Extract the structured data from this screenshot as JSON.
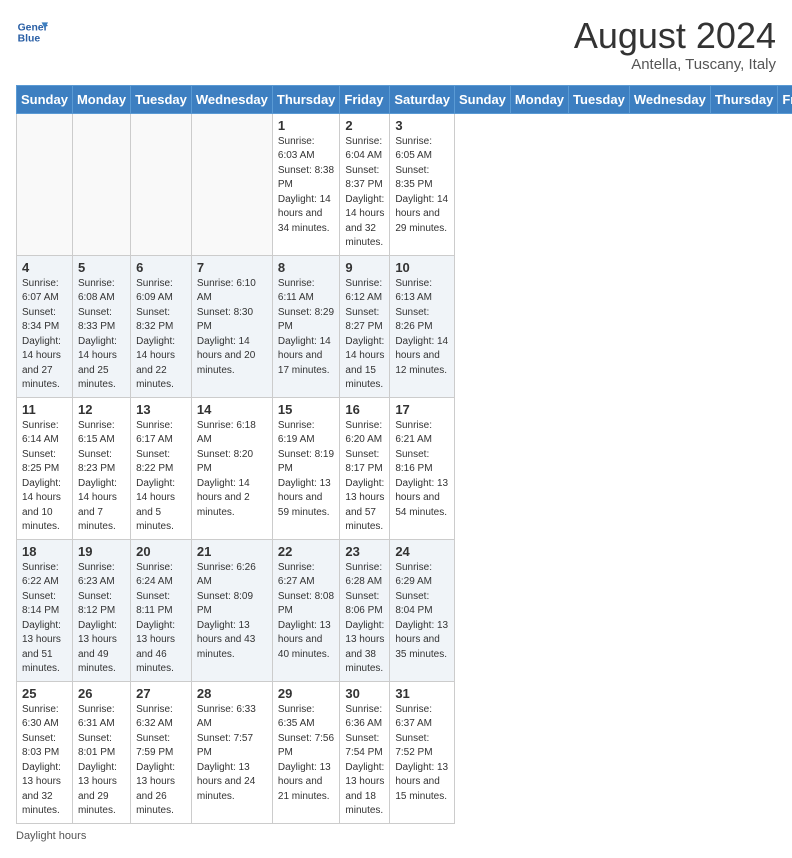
{
  "header": {
    "logo_line1": "General",
    "logo_line2": "Blue",
    "month_year": "August 2024",
    "location": "Antella, Tuscany, Italy"
  },
  "days_of_week": [
    "Sunday",
    "Monday",
    "Tuesday",
    "Wednesday",
    "Thursday",
    "Friday",
    "Saturday"
  ],
  "weeks": [
    [
      {
        "day": "",
        "info": ""
      },
      {
        "day": "",
        "info": ""
      },
      {
        "day": "",
        "info": ""
      },
      {
        "day": "",
        "info": ""
      },
      {
        "day": "1",
        "info": "Sunrise: 6:03 AM\nSunset: 8:38 PM\nDaylight: 14 hours and 34 minutes."
      },
      {
        "day": "2",
        "info": "Sunrise: 6:04 AM\nSunset: 8:37 PM\nDaylight: 14 hours and 32 minutes."
      },
      {
        "day": "3",
        "info": "Sunrise: 6:05 AM\nSunset: 8:35 PM\nDaylight: 14 hours and 29 minutes."
      }
    ],
    [
      {
        "day": "4",
        "info": "Sunrise: 6:07 AM\nSunset: 8:34 PM\nDaylight: 14 hours and 27 minutes."
      },
      {
        "day": "5",
        "info": "Sunrise: 6:08 AM\nSunset: 8:33 PM\nDaylight: 14 hours and 25 minutes."
      },
      {
        "day": "6",
        "info": "Sunrise: 6:09 AM\nSunset: 8:32 PM\nDaylight: 14 hours and 22 minutes."
      },
      {
        "day": "7",
        "info": "Sunrise: 6:10 AM\nSunset: 8:30 PM\nDaylight: 14 hours and 20 minutes."
      },
      {
        "day": "8",
        "info": "Sunrise: 6:11 AM\nSunset: 8:29 PM\nDaylight: 14 hours and 17 minutes."
      },
      {
        "day": "9",
        "info": "Sunrise: 6:12 AM\nSunset: 8:27 PM\nDaylight: 14 hours and 15 minutes."
      },
      {
        "day": "10",
        "info": "Sunrise: 6:13 AM\nSunset: 8:26 PM\nDaylight: 14 hours and 12 minutes."
      }
    ],
    [
      {
        "day": "11",
        "info": "Sunrise: 6:14 AM\nSunset: 8:25 PM\nDaylight: 14 hours and 10 minutes."
      },
      {
        "day": "12",
        "info": "Sunrise: 6:15 AM\nSunset: 8:23 PM\nDaylight: 14 hours and 7 minutes."
      },
      {
        "day": "13",
        "info": "Sunrise: 6:17 AM\nSunset: 8:22 PM\nDaylight: 14 hours and 5 minutes."
      },
      {
        "day": "14",
        "info": "Sunrise: 6:18 AM\nSunset: 8:20 PM\nDaylight: 14 hours and 2 minutes."
      },
      {
        "day": "15",
        "info": "Sunrise: 6:19 AM\nSunset: 8:19 PM\nDaylight: 13 hours and 59 minutes."
      },
      {
        "day": "16",
        "info": "Sunrise: 6:20 AM\nSunset: 8:17 PM\nDaylight: 13 hours and 57 minutes."
      },
      {
        "day": "17",
        "info": "Sunrise: 6:21 AM\nSunset: 8:16 PM\nDaylight: 13 hours and 54 minutes."
      }
    ],
    [
      {
        "day": "18",
        "info": "Sunrise: 6:22 AM\nSunset: 8:14 PM\nDaylight: 13 hours and 51 minutes."
      },
      {
        "day": "19",
        "info": "Sunrise: 6:23 AM\nSunset: 8:12 PM\nDaylight: 13 hours and 49 minutes."
      },
      {
        "day": "20",
        "info": "Sunrise: 6:24 AM\nSunset: 8:11 PM\nDaylight: 13 hours and 46 minutes."
      },
      {
        "day": "21",
        "info": "Sunrise: 6:26 AM\nSunset: 8:09 PM\nDaylight: 13 hours and 43 minutes."
      },
      {
        "day": "22",
        "info": "Sunrise: 6:27 AM\nSunset: 8:08 PM\nDaylight: 13 hours and 40 minutes."
      },
      {
        "day": "23",
        "info": "Sunrise: 6:28 AM\nSunset: 8:06 PM\nDaylight: 13 hours and 38 minutes."
      },
      {
        "day": "24",
        "info": "Sunrise: 6:29 AM\nSunset: 8:04 PM\nDaylight: 13 hours and 35 minutes."
      }
    ],
    [
      {
        "day": "25",
        "info": "Sunrise: 6:30 AM\nSunset: 8:03 PM\nDaylight: 13 hours and 32 minutes."
      },
      {
        "day": "26",
        "info": "Sunrise: 6:31 AM\nSunset: 8:01 PM\nDaylight: 13 hours and 29 minutes."
      },
      {
        "day": "27",
        "info": "Sunrise: 6:32 AM\nSunset: 7:59 PM\nDaylight: 13 hours and 26 minutes."
      },
      {
        "day": "28",
        "info": "Sunrise: 6:33 AM\nSunset: 7:57 PM\nDaylight: 13 hours and 24 minutes."
      },
      {
        "day": "29",
        "info": "Sunrise: 6:35 AM\nSunset: 7:56 PM\nDaylight: 13 hours and 21 minutes."
      },
      {
        "day": "30",
        "info": "Sunrise: 6:36 AM\nSunset: 7:54 PM\nDaylight: 13 hours and 18 minutes."
      },
      {
        "day": "31",
        "info": "Sunrise: 6:37 AM\nSunset: 7:52 PM\nDaylight: 13 hours and 15 minutes."
      }
    ]
  ],
  "footer": {
    "daylight_label": "Daylight hours"
  }
}
